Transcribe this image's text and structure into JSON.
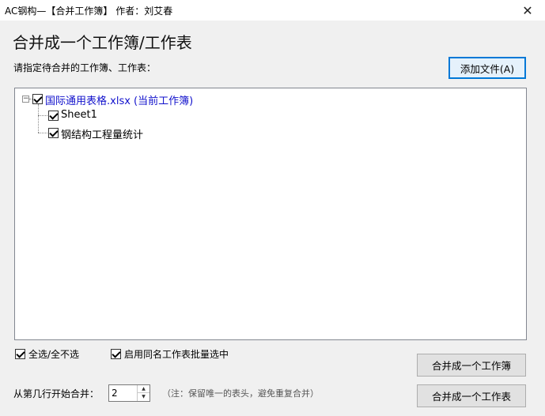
{
  "window": {
    "title": "AC钢构—【合并工作簿】 作者：刘艾春",
    "close_glyph": "✕"
  },
  "heading": "合并成一个工作簿/工作表",
  "prompt": "请指定待合并的工作簿、工作表：",
  "buttons": {
    "add_file": "添加文件(A)",
    "merge_workbook": "合并成一个工作簿",
    "merge_worksheet": "合并成一个工作表"
  },
  "tree": {
    "root": {
      "label": "国际通用表格.xlsx (当前工作簿)",
      "checked": true,
      "expanded": true,
      "expander_glyph": "−",
      "color": "#1111cc"
    },
    "children": [
      {
        "label": "Sheet1",
        "checked": true
      },
      {
        "label": "钢结构工程量统计",
        "checked": true
      }
    ]
  },
  "options": {
    "select_all_label": "全选/全不选",
    "select_all_checked": true,
    "batch_same_name_label": "启用同名工作表批量选中",
    "batch_same_name_checked": true
  },
  "start_row": {
    "label": "从第几行开始合并：",
    "value": "2",
    "note": "（注：保留唯一的表头，避免重复合并）"
  },
  "icons": {
    "spinner_up": "▲",
    "spinner_down": "▼"
  },
  "colors": {
    "accent": "#0078d7",
    "root_text": "#1111cc",
    "background": "#f0f0f0"
  }
}
